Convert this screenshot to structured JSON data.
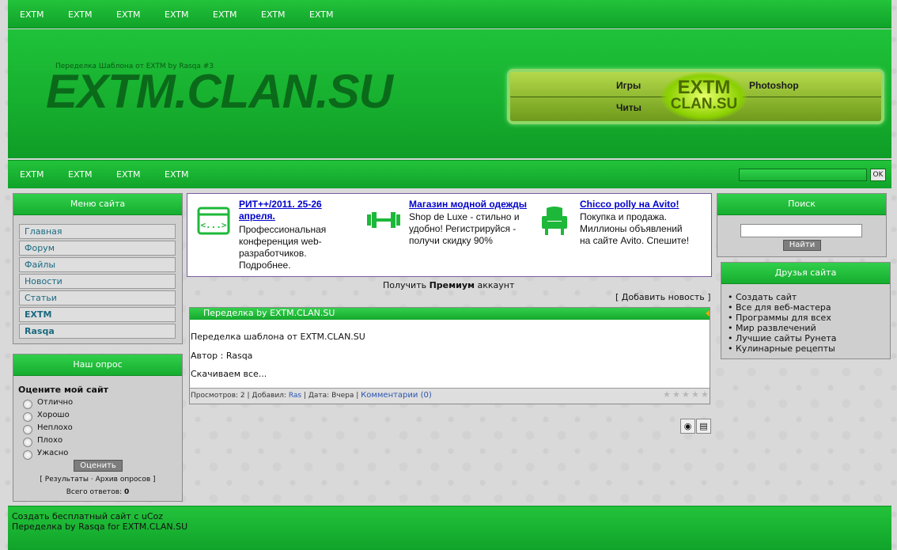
{
  "top_nav": [
    "EXTM",
    "EXTM",
    "EXTM",
    "EXTM",
    "EXTM",
    "EXTM",
    "EXTM"
  ],
  "header": {
    "subtitle": "Переделка Шаблона от EXTM by Rasqa #3",
    "title": "EXTM.CLAN.SU",
    "banner": {
      "games": "Игры",
      "cheats": "Читы",
      "photoshop": "Photoshop",
      "logo_top": "EXTM",
      "logo_bottom": "CLAN.SU"
    }
  },
  "sub_nav": [
    "EXTM",
    "EXTM",
    "EXTM",
    "EXTM"
  ],
  "sub_search": {
    "button": "OK"
  },
  "site_menu": {
    "title": "Меню сайта",
    "items": [
      "Главная",
      "Форум",
      "Файлы",
      "Новости",
      "Статьи",
      "EXTM",
      "Rasqa"
    ]
  },
  "poll": {
    "title": "Наш опрос",
    "question": "Оцените мой сайт",
    "options": [
      "Отлично",
      "Хорошо",
      "Неплохо",
      "Плохо",
      "Ужасно"
    ],
    "vote_button": "Оценить",
    "results_link": "[ Результаты · Архив опросов ]",
    "total_label": "Всего ответов:",
    "total_value": "0"
  },
  "ads": [
    {
      "title": "РИТ++/2011. 25-26 апреля.",
      "text": "Профессиональная конференция web-разработчиков. Подробнее.",
      "icon": "code-window-icon"
    },
    {
      "title": "Магазин модной одежды",
      "text": "Shop de Luxe - стильно и удобно! Регистрируйся - получи скидку 90%",
      "icon": "dumbbell-icon"
    },
    {
      "title": "Chicco polly на Avito!",
      "text": "Покупка и продажа. Миллионы объявлений на сайте Avito. Спешите!",
      "icon": "armchair-icon"
    }
  ],
  "premium": {
    "prefix": "Получить",
    "bold": "Премиум",
    "suffix": "аккаунт"
  },
  "add_news": "[ Добавить новость ]",
  "news": {
    "title": "Переделка by EXTM.CLAN.SU",
    "lines": [
      "Переделка шаблона от EXTM.CLAN.SU",
      "Автор : Rasqa",
      "Скачиваем все..."
    ],
    "views_label": "Просмотров:",
    "views": "2",
    "added_label": "Добавил:",
    "author": "Ras",
    "date_label": "Дата:",
    "date": "Вчера",
    "comments": "Комментарии (0)",
    "rating": 0
  },
  "search": {
    "title": "Поиск",
    "button": "Найти"
  },
  "friends": {
    "title": "Друзья сайта",
    "items": [
      "Создать сайт",
      "Все для веб-мастера",
      "Программы для всех",
      "Мир развлечений",
      "Лучшие сайты Рунета",
      "Кулинарные рецепты"
    ]
  },
  "footer": {
    "line1": "Создать бесплатный сайт с uCoz",
    "line2": "Переделка by Rasqa for EXTM.CLAN.SU"
  },
  "colors": {
    "green": "#16ad2f",
    "dark_green": "#0a6a1a",
    "link": "#0000cc",
    "menu_text": "#1a6a80"
  }
}
